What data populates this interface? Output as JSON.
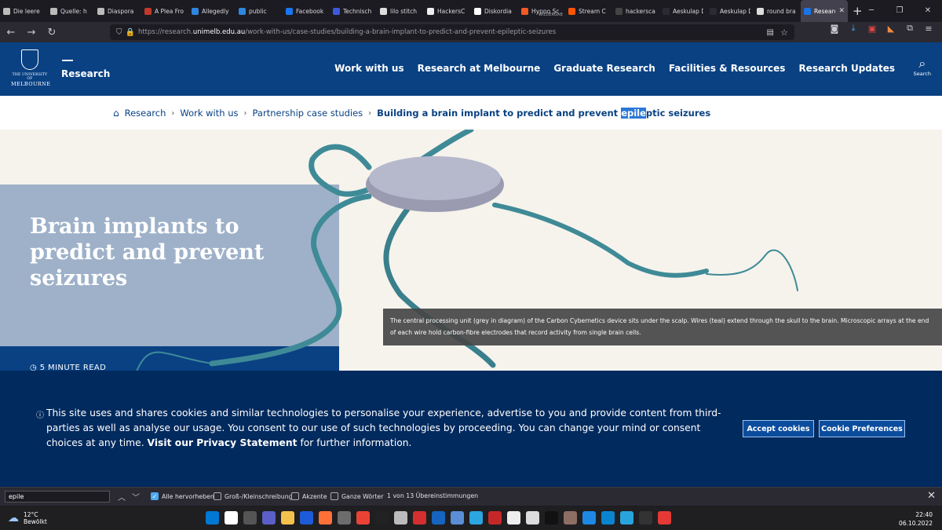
{
  "browser": {
    "tabs": [
      {
        "label": "Die leere",
        "color": "#bbbbbb"
      },
      {
        "label": "Quelle: h",
        "color": "#bbbbbb"
      },
      {
        "label": "Diaspora",
        "color": "#bbbbbb"
      },
      {
        "label": "A Plea Fro",
        "color": "#c0392b"
      },
      {
        "label": "Allegedly",
        "color": "#2e86de"
      },
      {
        "label": "public",
        "color": "#2e86de"
      },
      {
        "label": "Facebook",
        "color": "#1877f2"
      },
      {
        "label": "Technisch",
        "color": "#3b5bdb"
      },
      {
        "label": "lilo stitch",
        "color": "#dddddd"
      },
      {
        "label": "HackersC",
        "color": "#eeeeee"
      },
      {
        "label": "Diskordia",
        "color": "#ffffff"
      },
      {
        "label": "Hypno Sc",
        "sub": "WIEDERGAB",
        "color": "#f15a24"
      },
      {
        "label": "Stream C",
        "color": "#ff5500"
      },
      {
        "label": "hackersca",
        "color": "#444444"
      },
      {
        "label": "Aeskulap DIC",
        "color": "#2b2a33"
      },
      {
        "label": "Aeskulap DIC",
        "color": "#2b2a33"
      },
      {
        "label": "round bra",
        "color": "#dddddd"
      },
      {
        "label": "Researc",
        "color": "#1a73e8"
      }
    ],
    "url_prefix": "https://research.",
    "url_host": "unimelb.edu.au",
    "url_path": "/work-with-us/case-studies/building-a-brain-implant-to-predict-and-prevent-epileptic-seizures"
  },
  "header": {
    "logo_line1": "THE UNIVERSITY OF",
    "logo_line2": "MELBOURNE",
    "brand": "Research",
    "nav": [
      "Work with us",
      "Research at Melbourne",
      "Graduate Research",
      "Facilities & Resources",
      "Research Updates"
    ],
    "search_label": "Search"
  },
  "breadcrumb": {
    "items": [
      "Research",
      "Work with us",
      "Partnership case studies"
    ],
    "current_before": "Building a brain implant to predict and prevent ",
    "current_highlight": "epile",
    "current_after": "ptic seizures"
  },
  "hero": {
    "title": "Brain implants to predict and prevent seizures",
    "read_time": "5 MINUTE READ",
    "caption": "The central processing unit (grey in diagram) of the Carbon Cybernetics device sits under the scalp. Wires (teal) extend through the skull to the brain. Microscopic arrays at the end of each wire hold carbon-fibre electrodes that record activity from single brain cells."
  },
  "cookie": {
    "text": "This site uses and shares cookies and similar technologies to personalise your experience, advertise to you and provide content from third-parties as well as analyse our usage. You consent to our use of such technologies by proceeding. You can change your mind or consent choices at any time. ",
    "link": "Visit our Privacy Statement",
    "text_after": " for further information.",
    "accept": "Accept cookies",
    "preferences": "Cookie Preferences"
  },
  "findbar": {
    "query": "epile",
    "highlight_all": "Alle hervorheben",
    "match_case": "Groß-/Kleinschreibung",
    "diacritics": "Akzente",
    "whole_words": "Ganze Wörter",
    "result": "1 von 13 Übereinstimmungen"
  },
  "taskbar": {
    "temp": "12°C",
    "condition": "Bewölkt",
    "time": "22:40",
    "date": "06.10.2022"
  }
}
